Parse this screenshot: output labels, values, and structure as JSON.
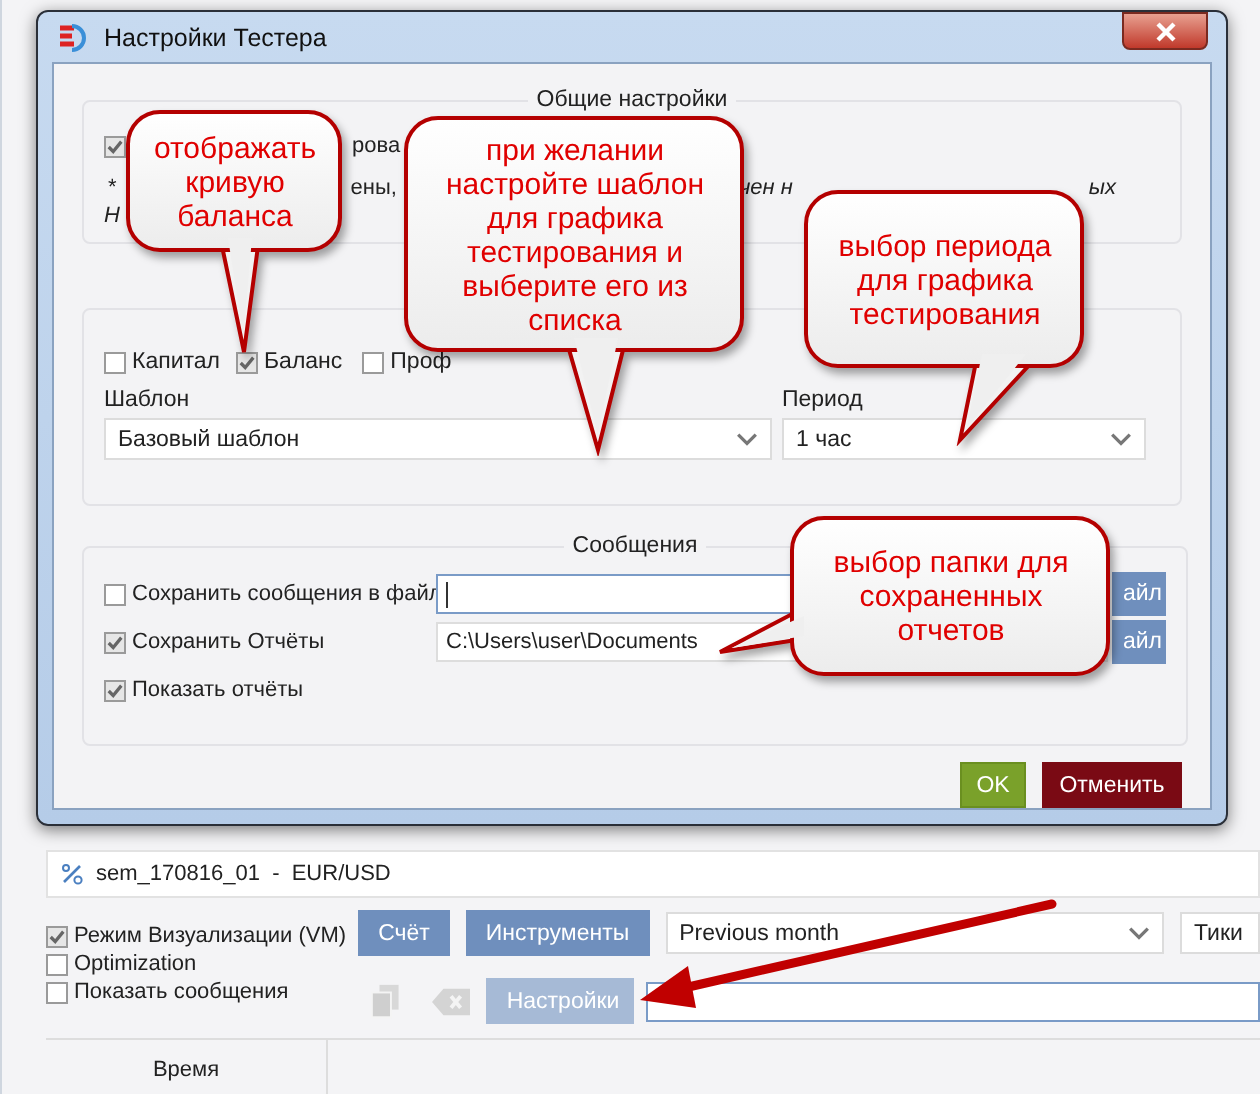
{
  "window": {
    "title": "Настройки Тестера"
  },
  "general_settings": {
    "title": "Общие настройки",
    "checkbox": {
      "checked": true,
      "label": "рова"
    },
    "note_line_1": [
      "*",
      "ены,",
      "чен н",
      "ых"
    ],
    "note_line_2": "Н"
  },
  "chart_settings": {
    "checkboxes": [
      {
        "label": "Капитал",
        "checked": false
      },
      {
        "label": "Баланс",
        "checked": true
      },
      {
        "label": "Проф",
        "checked": false
      }
    ],
    "template": {
      "label": "Шаблон",
      "value": "Базовый шаблон"
    },
    "period": {
      "label": "Период",
      "value": "1 час"
    }
  },
  "messages": {
    "title": "Сообщения",
    "rows": [
      {
        "label": "Сохранить сообщения в файл",
        "checked": false,
        "kind": "path",
        "value": "",
        "button": "айл",
        "focused": true
      },
      {
        "label": "Сохранить Отчёты",
        "checked": true,
        "kind": "path",
        "value": "C:\\Users\\user\\Documents",
        "button": "айл",
        "focused": false
      },
      {
        "label": "Показать отчёты",
        "checked": true,
        "kind": "check"
      }
    ]
  },
  "buttons": {
    "ok": "OK",
    "cancel": "Отменить"
  },
  "callouts": [
    "отображать кривую баланса",
    "при желании настройте шаблон для графика тестирования и выберите его из списка",
    "выбор периода для графика тестирования",
    "выбор папки для сохраненных отчетов"
  ],
  "app": {
    "strategy": "sem_170816_01  -  EUR/USD",
    "options": [
      {
        "label": "Режим Визуализации (VM)",
        "checked": true
      },
      {
        "label": "Optimization",
        "checked": false
      },
      {
        "label": "Показать сообщения",
        "checked": false
      }
    ],
    "account_button": "Счёт",
    "instruments_button": "Инструменты",
    "range": "Previous month",
    "mode": "Тики",
    "settings_button": "Настройки",
    "table": {
      "columns": [
        "Время"
      ]
    }
  }
}
